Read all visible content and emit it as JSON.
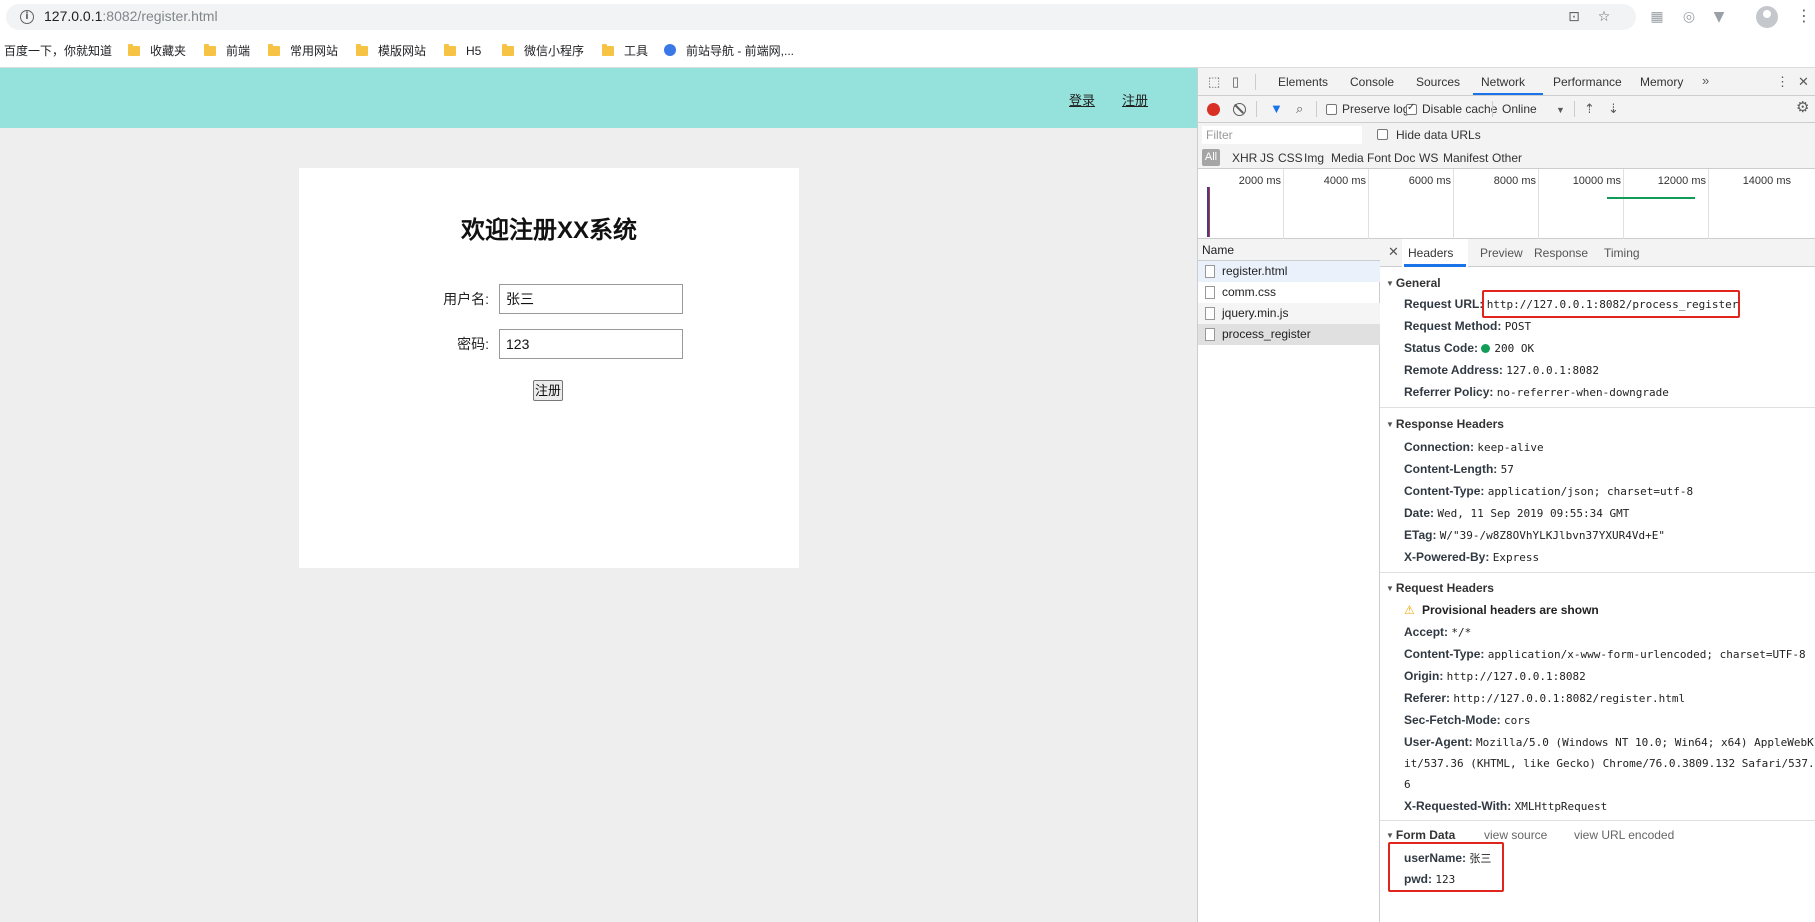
{
  "browser": {
    "url_host": "127.0.0.1",
    "url_rest": ":8082/register.html",
    "bookmarks": [
      {
        "label": "百度一下，你就知道",
        "icon": "none"
      },
      {
        "label": "收藏夹",
        "icon": "folder-icon"
      },
      {
        "label": "前端",
        "icon": "folder-icon"
      },
      {
        "label": "常用网站",
        "icon": "folder-icon"
      },
      {
        "label": "模版网站",
        "icon": "folder-icon"
      },
      {
        "label": "H5",
        "icon": "folder-icon"
      },
      {
        "label": "微信小程序",
        "icon": "folder-icon"
      },
      {
        "label": "工具",
        "icon": "folder-icon"
      },
      {
        "label": "前站导航 - 前端网,...",
        "icon": "globe-icon"
      }
    ]
  },
  "page": {
    "nav": {
      "login": "登录",
      "register": "注册"
    },
    "title": "欢迎注册XX系统",
    "form": {
      "username_label": "用户名:",
      "username_value": "张三",
      "password_label": "密码:",
      "password_value": "123",
      "submit_label": "注册"
    },
    "colors": {
      "topbar": "#94e2db",
      "background": "#eeeeee"
    }
  },
  "devtools": {
    "tabs": [
      "Elements",
      "Console",
      "Sources",
      "Network",
      "Performance",
      "Memory"
    ],
    "active_tab": "Network",
    "toolbar": {
      "preserve_log": "Preserve log",
      "disable_cache": "Disable cache",
      "throttle": "Online"
    },
    "filter_placeholder": "Filter",
    "hide_data_urls": "Hide data URLs",
    "types": [
      "All",
      "XHR",
      "JS",
      "CSS",
      "Img",
      "Media",
      "Font",
      "Doc",
      "WS",
      "Manifest",
      "Other"
    ],
    "timeline_ticks": [
      "2000 ms",
      "4000 ms",
      "6000 ms",
      "8000 ms",
      "10000 ms",
      "12000 ms",
      "14000 ms"
    ],
    "name_header": "Name",
    "requests": [
      "register.html",
      "comm.css",
      "jquery.min.js",
      "process_register"
    ],
    "detail_tabs": [
      "Headers",
      "Preview",
      "Response",
      "Timing"
    ],
    "general": {
      "title": "General",
      "rows": [
        {
          "key": "Request URL:",
          "value": "http://127.0.0.1:8082/process_register"
        },
        {
          "key": "Request Method:",
          "value": "POST"
        },
        {
          "key": "Status Code:",
          "value": "200 OK"
        },
        {
          "key": "Remote Address:",
          "value": "127.0.0.1:8082"
        },
        {
          "key": "Referrer Policy:",
          "value": "no-referrer-when-downgrade"
        }
      ]
    },
    "response_headers": {
      "title": "Response Headers",
      "rows": [
        {
          "key": "Connection:",
          "value": "keep-alive"
        },
        {
          "key": "Content-Length:",
          "value": "57"
        },
        {
          "key": "Content-Type:",
          "value": "application/json; charset=utf-8"
        },
        {
          "key": "Date:",
          "value": "Wed, 11 Sep 2019 09:55:34 GMT"
        },
        {
          "key": "ETag:",
          "value": "W/\"39-/w8Z8OVhYLKJlbvn37YXUR4Vd+E\""
        },
        {
          "key": "X-Powered-By:",
          "value": "Express"
        }
      ]
    },
    "request_headers": {
      "title": "Request Headers",
      "warning": "Provisional headers are shown",
      "rows": [
        {
          "key": "Accept:",
          "value": "*/*"
        },
        {
          "key": "Content-Type:",
          "value": "application/x-www-form-urlencoded; charset=UTF-8"
        },
        {
          "key": "Origin:",
          "value": "http://127.0.0.1:8082"
        },
        {
          "key": "Referer:",
          "value": "http://127.0.0.1:8082/register.html"
        },
        {
          "key": "Sec-Fetch-Mode:",
          "value": "cors"
        },
        {
          "key": "User-Agent:",
          "value": "Mozilla/5.0 (Windows NT 10.0; Win64; x64) AppleWebK"
        },
        {
          "key": "",
          "value": "it/537.36 (KHTML, like Gecko) Chrome/76.0.3809.132 Safari/537."
        },
        {
          "key": "",
          "value": "6"
        },
        {
          "key": "X-Requested-With:",
          "value": "XMLHttpRequest"
        }
      ]
    },
    "form_data": {
      "title": "Form Data",
      "view_source": "view source",
      "view_url_encoded": "view URL encoded",
      "rows": [
        {
          "key": "userName:",
          "value": "张三"
        },
        {
          "key": "pwd:",
          "value": "123"
        }
      ]
    }
  }
}
